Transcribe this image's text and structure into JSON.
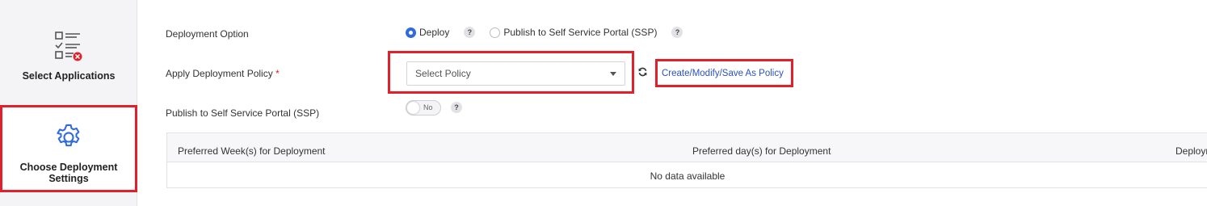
{
  "sidebar": {
    "steps": [
      {
        "label": "Select Applications",
        "icon": "checklist-remove-icon"
      },
      {
        "label": "Choose Deployment Settings",
        "icon": "gear-icon"
      }
    ]
  },
  "form": {
    "deployment_option": {
      "label": "Deployment Option",
      "options": [
        {
          "label": "Deploy",
          "selected": true
        },
        {
          "label": "Publish to Self Service Portal (SSP)",
          "selected": false
        }
      ],
      "help": "?"
    },
    "policy": {
      "label": "Apply Deployment Policy",
      "required_mark": "*",
      "placeholder": "Select Policy",
      "link": "Create/Modify/Save As Policy"
    },
    "ssp": {
      "label": "Publish to Self Service Portal (SSP)",
      "toggle_text": "No",
      "help": "?"
    }
  },
  "table": {
    "columns": [
      "Preferred Week(s) for Deployment",
      "Preferred day(s) for Deployment",
      "Deploym"
    ],
    "empty_text": "No data available"
  },
  "colors": {
    "highlight": "#e0202a",
    "accent": "#2f6bdc",
    "link": "#2a51c4"
  }
}
